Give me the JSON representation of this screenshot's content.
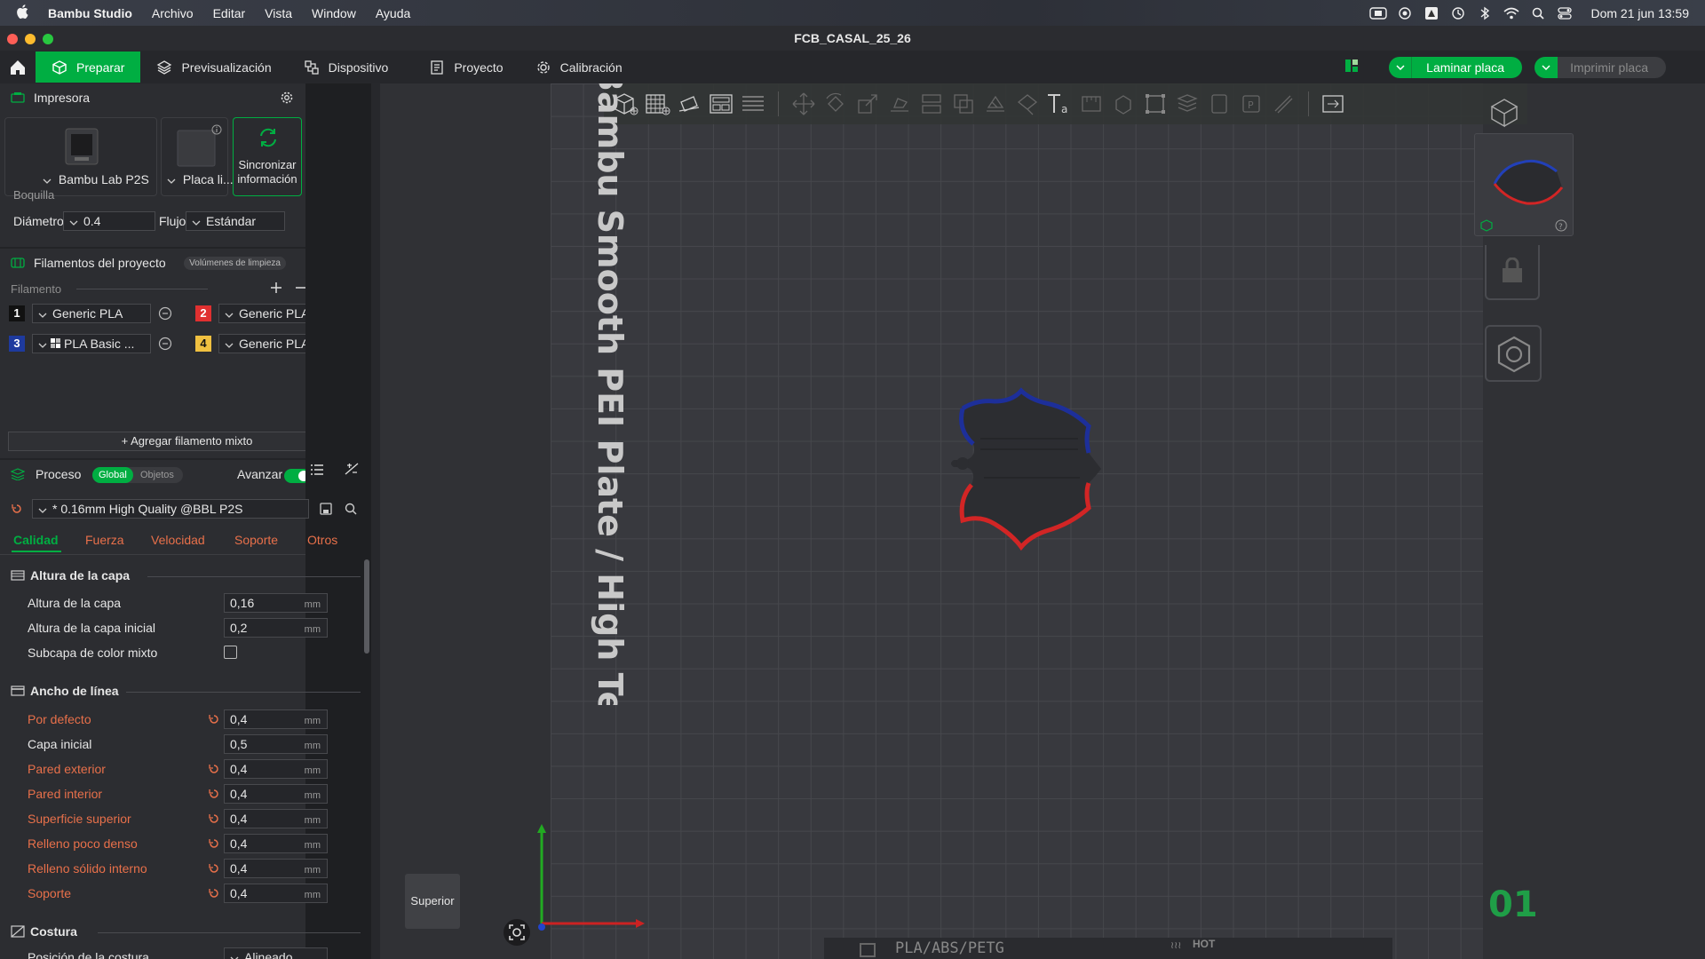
{
  "menubar": {
    "items": [
      "Bambu Studio",
      "Archivo",
      "Editar",
      "Vista",
      "Window",
      "Ayuda"
    ],
    "clock": "Dom 21 jun 13:59"
  },
  "window": {
    "title": "FCB_CASAL_25_26"
  },
  "toolbar": {
    "tabs": [
      "Preparar",
      "Previsualización",
      "Dispositivo",
      "Proyecto",
      "Calibración"
    ],
    "slice_label": "Laminar placa",
    "print_label": "Imprimir placa"
  },
  "printer": {
    "header": "Impresora",
    "printer_name": "Bambu Lab P2S",
    "plate_name": "Placa li...",
    "sync_label_1": "Sincronizar",
    "sync_label_2": "información",
    "nozzle_title": "Boquilla",
    "diameter_label": "Diámetro",
    "diameter_value": "0.4",
    "flow_label": "Flujo",
    "flow_value": "Estándar"
  },
  "filaments": {
    "header": "Filamentos del proyecto",
    "flush_button": "Volúmenes de limpieza",
    "list_label": "Filamento",
    "items": [
      {
        "num": "1",
        "name": "Generic PLA",
        "color": "#111111"
      },
      {
        "num": "2",
        "name": "Generic PLA",
        "color": "#e03030"
      },
      {
        "num": "3",
        "name": "PLA Basic ...",
        "color": "#1e3a9e"
      },
      {
        "num": "4",
        "name": "Generic PLA",
        "color": "#f0c040"
      }
    ],
    "add_mixed": "Agregar filamento mixto"
  },
  "process": {
    "header": "Proceso",
    "toggle_global": "Global",
    "toggle_objects": "Objetos",
    "advanced_label": "Avanzar",
    "preset": "* 0.16mm High Quality @BBL P2S",
    "tabs": [
      "Calidad",
      "Fuerza",
      "Velocidad",
      "Soporte",
      "Otros"
    ],
    "group_layer": "Altura de la capa",
    "layer_height_label": "Altura de la capa",
    "layer_height_value": "0,16",
    "initial_layer_label": "Altura de la capa inicial",
    "initial_layer_value": "0,2",
    "mixed_sub_label": "Subcapa de color mixto",
    "group_width": "Ancho de línea",
    "width_rows": [
      {
        "label": "Por defecto",
        "value": "0,4"
      },
      {
        "label": "Capa inicial",
        "value": "0,5"
      },
      {
        "label": "Pared exterior",
        "value": "0,4"
      },
      {
        "label": "Pared interior",
        "value": "0,4"
      },
      {
        "label": "Superficie superior",
        "value": "0,4"
      },
      {
        "label": "Relleno poco denso",
        "value": "0,4"
      },
      {
        "label": "Relleno sólido interno",
        "value": "0,4"
      },
      {
        "label": "Soporte",
        "value": "0,4"
      }
    ],
    "unit": "mm",
    "group_seam": "Costura",
    "seam_label": "Posición de la costura",
    "seam_value": "Alineado"
  },
  "viewport": {
    "plate_text": "Bambu Smooth PEI Plate / High Temp Plate",
    "view_label": "Superior",
    "plate_number": "01",
    "bottom_text": "PLA/ABS/PETG",
    "hot_text": "HOT"
  }
}
